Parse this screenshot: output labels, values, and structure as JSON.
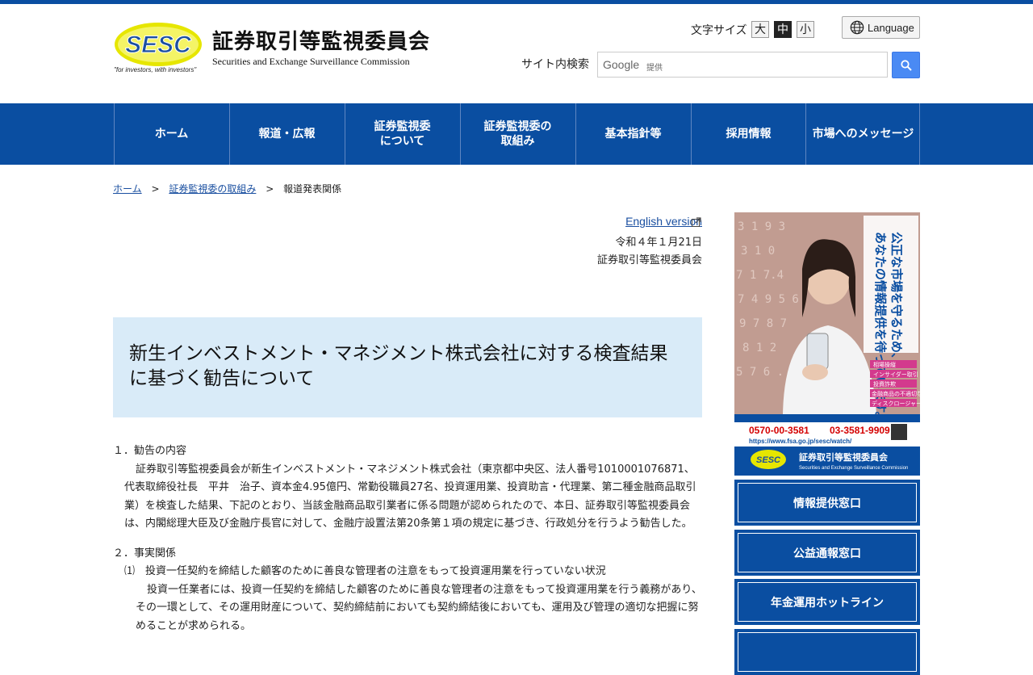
{
  "header": {
    "logo_text": "SESC",
    "logo_tagline": "\"for investors, with investors\"",
    "org_name_jp": "証券取引等監視委員会",
    "org_name_en": "Securities and Exchange Surveillance Commission",
    "font_size_label": "文字サイズ",
    "font_sizes": [
      "大",
      "中",
      "小"
    ],
    "font_size_selected": "中",
    "language_label": "Language",
    "search_label": "サイト内検索",
    "search_brand": "Google",
    "search_provided": "提供"
  },
  "nav": {
    "items": [
      "ホーム",
      "報道・広報",
      "証券監視委\nについて",
      "証券監視委の\n取組み",
      "基本指針等",
      "採用情報",
      "市場へのメッセージ"
    ]
  },
  "breadcrumb": {
    "home": "ホーム",
    "section": "証券監視委の取組み",
    "current": "報道発表関係",
    "separator": ">"
  },
  "article": {
    "english_link": "English version",
    "date": "令和４年１月21日",
    "issuer": "証券取引等監視委員会",
    "title": "新生インベストメント・マネジメント株式会社に対する検査結果に基づく勧告について",
    "section1_heading": "１．勧告の内容",
    "section1_text": "証券取引等監視委員会が新生インベストメント・マネジメント株式会社（東京都中央区、法人番号1010001076871、代表取締役社長　平井　治子、資本金4.95億円、常勤役職員27名、投資運用業、投資助言・代理業、第二種金融商品取引業）を検査した結果、下記のとおり、当該金融商品取引業者に係る問題が認められたので、本日、証券取引等監視委員会は、内閣総理大臣及び金融庁長官に対して、金融庁設置法第20条第１項の規定に基づき、行政処分を行うよう勧告した。",
    "section2_heading": "２．事実関係",
    "item1_heading": "⑴　投資一任契約を締結した顧客のために善良な管理者の注意をもって投資運用業を行っていない状況",
    "item1_text": "投資一任業者には、投資一任契約を締結した顧客のために善良な管理者の注意をもって投資運用業を行う義務があり、その一環として、その運用財産について、契約締結前においても契約締結後においても、運用及び管理の適切な把握に努めることが求められる。"
  },
  "sidebar": {
    "ad_slogan": "公正な市場を守るため、あなたの情報提供を待っています。",
    "ad_tags": [
      "相場操縦",
      "インサイダー取引",
      "投資詐欺",
      "金融商品の不適切な勧誘",
      "ディスクロージャー違反"
    ],
    "ad_phone1": "0570-00-3581",
    "ad_phone2": "03-3581-9909",
    "ad_url": "https://www.fsa.go.jp/sesc/watch/",
    "ad_org_jp": "証券取引等監視委員会",
    "ad_org_en": "Securities and Exchange Surveillance Commission",
    "buttons": [
      "情報提供窓口",
      "公益通報窓口",
      "年金運用ホットライン"
    ]
  },
  "colors": {
    "brand_blue": "#0a4ea1",
    "title_bg": "#d9ebf8",
    "link": "#1a4fa0",
    "logo_yellow": "#e6e600"
  }
}
